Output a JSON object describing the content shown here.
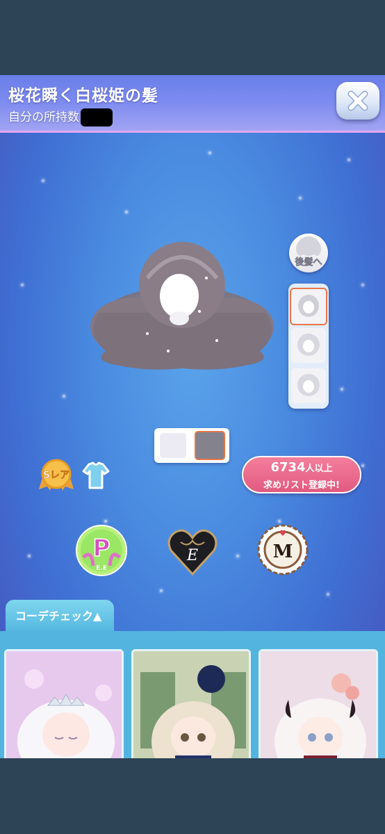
{
  "header": {
    "title": "桜花瞬く白桜姫の髪",
    "owned_label": "自分の所持数",
    "owned_value": "(redacted)",
    "close_icon": "close-x-icon"
  },
  "item_preview": {
    "back_button_label": "後髪へ",
    "variants": [
      "hair-variant-1",
      "hair-variant-2",
      "hair-variant-3"
    ],
    "selected_variant": 0,
    "colors": [
      "#ecebf3",
      "#84828c"
    ],
    "selected_color": 1
  },
  "badges": {
    "rarity_label": "Sレア",
    "category_icon": "outfit-icon"
  },
  "wishlist": {
    "count": "6734",
    "count_suffix": "人以上",
    "text": "求めリスト登録中!"
  },
  "brands": {
    "p_letter": "P",
    "p_sub": "E.E",
    "e_letter": "E",
    "m_letter": "M"
  },
  "coordinate": {
    "tab_label": "コーデチェック▲",
    "cards": [
      "coordinate-card-1",
      "coordinate-card-2",
      "coordinate-card-3"
    ]
  },
  "colors": {
    "accent": "#e8774a",
    "wish_pink": "#e25a80",
    "tab_blue": "#53b5df",
    "header_purple": "#7b8af0"
  }
}
